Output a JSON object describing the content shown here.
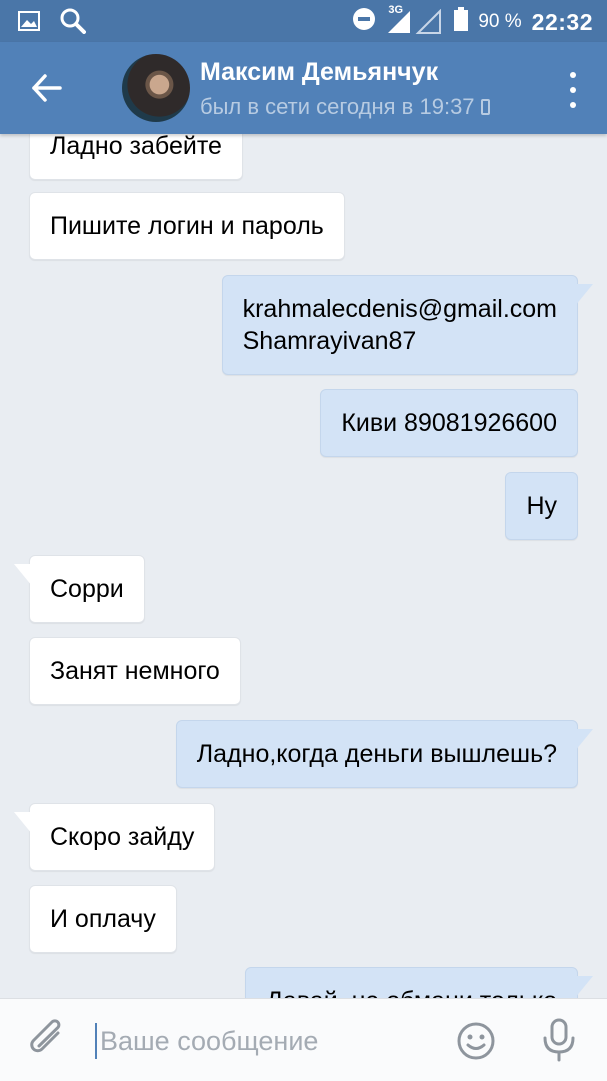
{
  "status_bar": {
    "network": "3G",
    "battery_percent": "90 %",
    "time": "22:32",
    "icons": [
      "image-icon",
      "search-icon",
      "dnd-icon",
      "signal-icon",
      "battery-icon"
    ]
  },
  "header": {
    "contact_name": "Максим Демьянчук",
    "last_seen": "был в сети сегодня в 19:37",
    "icons": [
      "back-arrow-icon",
      "avatar",
      "mobile-icon",
      "more-vert-icon"
    ]
  },
  "messages": [
    {
      "direction": "in",
      "text": "Ладно забейте"
    },
    {
      "direction": "in",
      "text": "Пишите логин и пароль"
    },
    {
      "direction": "out",
      "text": "krahmalecdenis@gmail.com\nShamrayivan87"
    },
    {
      "direction": "out",
      "text": "Киви 89081926600"
    },
    {
      "direction": "out",
      "text": "Ну"
    },
    {
      "direction": "in",
      "text": "Сорри"
    },
    {
      "direction": "in",
      "text": "Занят немного"
    },
    {
      "direction": "out",
      "text": "Ладно,когда деньги вышлешь?"
    },
    {
      "direction": "in",
      "text": "Скоро зайду"
    },
    {
      "direction": "in",
      "text": "И оплачу"
    },
    {
      "direction": "out",
      "text": "Давай, не обмани только"
    }
  ],
  "composer": {
    "placeholder": "Ваше сообщение",
    "value": "",
    "icons": [
      "attach-icon",
      "emoji-icon",
      "mic-icon"
    ]
  },
  "colors": {
    "status_bar": "#4a76a8",
    "header": "#5181b8",
    "background": "#e9edf2",
    "incoming_bubble": "#ffffff",
    "outgoing_bubble": "#d3e3f6"
  }
}
